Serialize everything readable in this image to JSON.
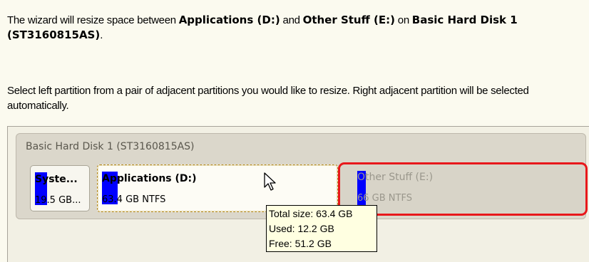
{
  "intro": {
    "prefix": "The wizard will resize space between ",
    "part1": "Applications (D:)",
    "and": " and ",
    "part2": "Other Stuff (E:)",
    "on": " on ",
    "disk": "Basic Hard Disk 1 (ST3160815AS)",
    "end": "."
  },
  "instruction": "Select left partition from a pair of adjacent partitions you would like to resize. Right adjacent partition will be selected automatically.",
  "disk": {
    "title": "Basic Hard Disk 1 (ST3160815AS)",
    "partitions": [
      {
        "label": "Syste...",
        "info": "19.5 GB..."
      },
      {
        "label": "Applications (D:)",
        "info": "63.4 GB NTFS"
      },
      {
        "label": "Other Stuff (E:)",
        "info": "66 GB NTFS"
      }
    ]
  },
  "tooltip": {
    "total": "Total size: 63.4 GB",
    "used": "Used: 12.2 GB",
    "free": "Free: 51.2 GB"
  },
  "colors": {
    "usage_bar": "#0000ff",
    "selection_outline": "#e8181b",
    "background": "#fbfaef",
    "tooltip_bg": "#ffffe1"
  },
  "icons": [
    "mouse-pointer-icon"
  ]
}
